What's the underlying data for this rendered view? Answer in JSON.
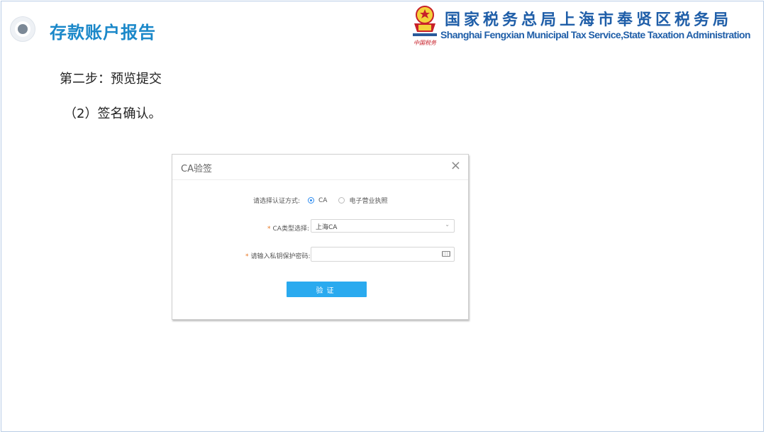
{
  "slide": {
    "title": "存款账户报告",
    "step": "第二步：预览提交",
    "substep": "（2）签名确认。"
  },
  "org": {
    "name_cn": "国家税务总局上海市奉贤区税务局",
    "name_en": "Shanghai Fengxian Municipal Tax Service,State Taxation  Administration",
    "emblem_caption": "中国税务"
  },
  "dialog": {
    "title": "CA验签",
    "close": "×",
    "auth_label": "请选择认证方式:",
    "auth_options": [
      "CA",
      "电子营业执照"
    ],
    "auth_selected": "CA",
    "ca_type_label": "CA类型选择:",
    "ca_type_value": "上海CA",
    "password_label": "请输入私钥保护密码:",
    "password_value": "",
    "required_mark": "*",
    "verify_label": "验证"
  },
  "colors": {
    "title_blue": "#1b88c9",
    "org_blue": "#1f5ea8",
    "button_blue": "#2aaaef",
    "required_orange": "#e8731c"
  }
}
